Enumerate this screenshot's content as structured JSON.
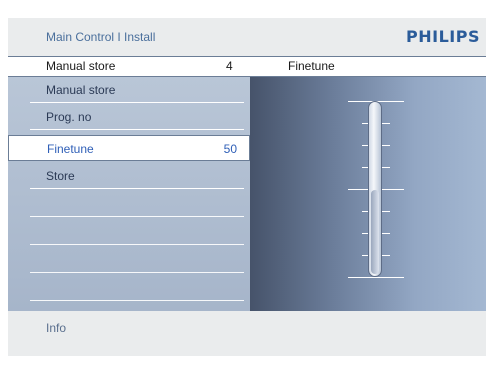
{
  "header": {
    "breadcrumb": "Main Control I Install",
    "brand": "PHILIPS"
  },
  "headrow": {
    "title": "Manual store",
    "number": "4",
    "right_title": "Finetune"
  },
  "menu": {
    "items": [
      {
        "label": "Manual store",
        "value": ""
      },
      {
        "label": "Prog. no",
        "value": ""
      },
      {
        "label": "Finetune",
        "value": "50"
      },
      {
        "label": "Store",
        "value": ""
      }
    ],
    "selected_index": 2
  },
  "slider": {
    "value_fraction": 0.5
  },
  "footer": {
    "info_label": "Info"
  },
  "colors": {
    "brand": "#2b5c9a",
    "selected_text": "#2f5fb7",
    "panel_bg": "#eaeced"
  }
}
